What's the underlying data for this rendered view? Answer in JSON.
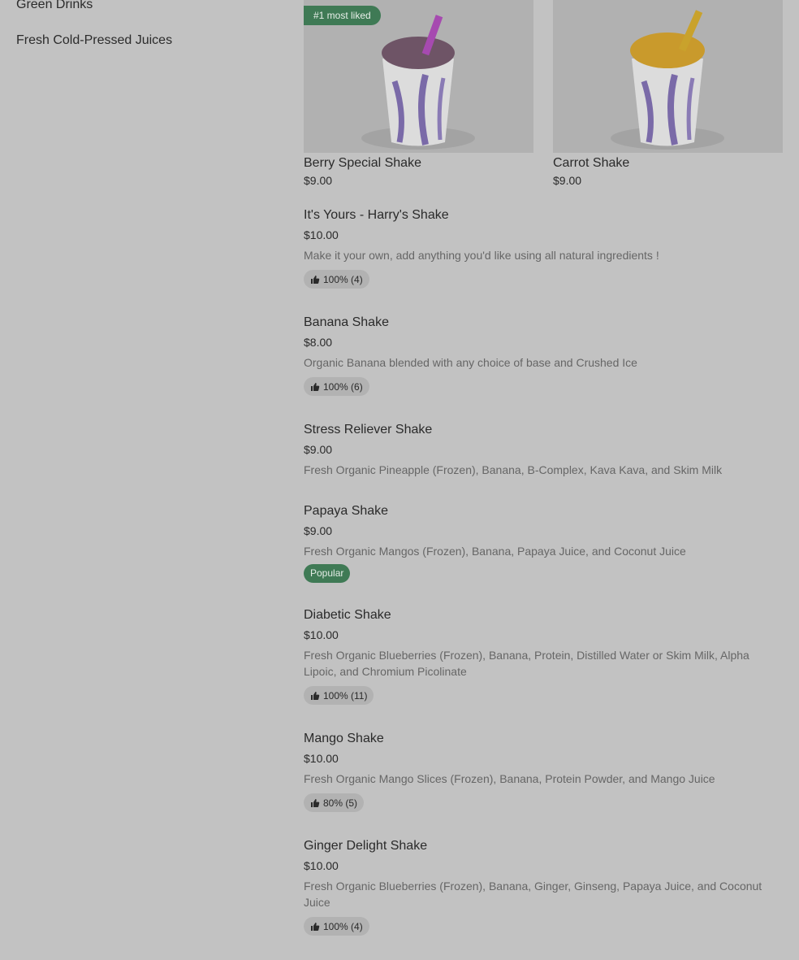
{
  "sidebar": {
    "items": [
      {
        "label": "Green Drinks"
      },
      {
        "label": "Fresh Cold-Pressed Juices"
      }
    ]
  },
  "featured": [
    {
      "badge": "#1 most liked",
      "name": "Berry Special Shake",
      "price": "$9.00",
      "drink_color": "#6e5466",
      "straw_color": "#a64ab0"
    },
    {
      "badge": "",
      "name": "Carrot Shake",
      "price": "$9.00",
      "drink_color": "#c99a2c",
      "straw_color": "#c9a22c"
    }
  ],
  "menu": [
    {
      "name": "It's Yours - Harry's Shake",
      "price": "$10.00",
      "description": "Make it your own, add anything you'd like using all natural ingredients !",
      "rating": "100% (4)",
      "tag": ""
    },
    {
      "name": "Banana Shake",
      "price": "$8.00",
      "description": "Organic Banana blended with any choice of base and Crushed Ice",
      "rating": "100% (6)",
      "tag": ""
    },
    {
      "name": "Stress Reliever Shake",
      "price": "$9.00",
      "description": "Fresh Organic Pineapple (Frozen), Banana, B-Complex, Kava Kava, and Skim Milk",
      "rating": "",
      "tag": ""
    },
    {
      "name": "Papaya Shake",
      "price": "$9.00",
      "description": "Fresh Organic Mangos (Frozen), Banana, Papaya Juice, and Coconut Juice",
      "rating": "",
      "tag": "Popular"
    },
    {
      "name": "Diabetic Shake",
      "price": "$10.00",
      "description": "Fresh Organic Blueberries (Frozen), Banana, Protein, Distilled Water or Skim Milk, Alpha Lipoic, and Chromium Picolinate",
      "rating": "100% (11)",
      "tag": ""
    },
    {
      "name": "Mango Shake",
      "price": "$10.00",
      "description": "Fresh Organic Mango Slices (Frozen), Banana, Protein Powder, and Mango Juice",
      "rating": "80% (5)",
      "tag": ""
    },
    {
      "name": "Ginger Delight Shake",
      "price": "$10.00",
      "description": "Fresh Organic Blueberries (Frozen), Banana, Ginger, Ginseng, Papaya Juice, and Coconut Juice",
      "rating": "100% (4)",
      "tag": ""
    }
  ],
  "icons": {
    "rating": "thumbs-up-icon"
  },
  "colors": {
    "overlay_background": "#c2c2c2",
    "badge_green": "#3f7a55",
    "rating_pill": "#b2b2b2"
  }
}
